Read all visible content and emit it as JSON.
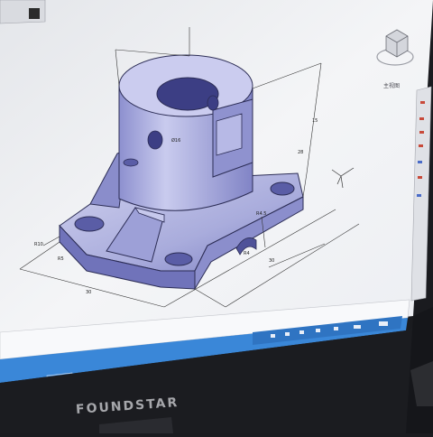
{
  "monitor": {
    "brand": "FOUNDSTAR"
  },
  "cad": {
    "dimensions": [
      "R10",
      "Ø16",
      "30",
      "30",
      "15",
      "28",
      "R4.5",
      "R5",
      "R4"
    ],
    "view_cube_label": "主视图"
  },
  "taskbar": {
    "time": "",
    "items": []
  },
  "colors": {
    "screen_bg": "#f2f3f6",
    "model_fill": "#a9acdc",
    "model_shadow": "#6f72b8",
    "model_light": "#d7d8f2",
    "taskbar": "#3a87d8",
    "bezel": "#1a1b1f"
  }
}
